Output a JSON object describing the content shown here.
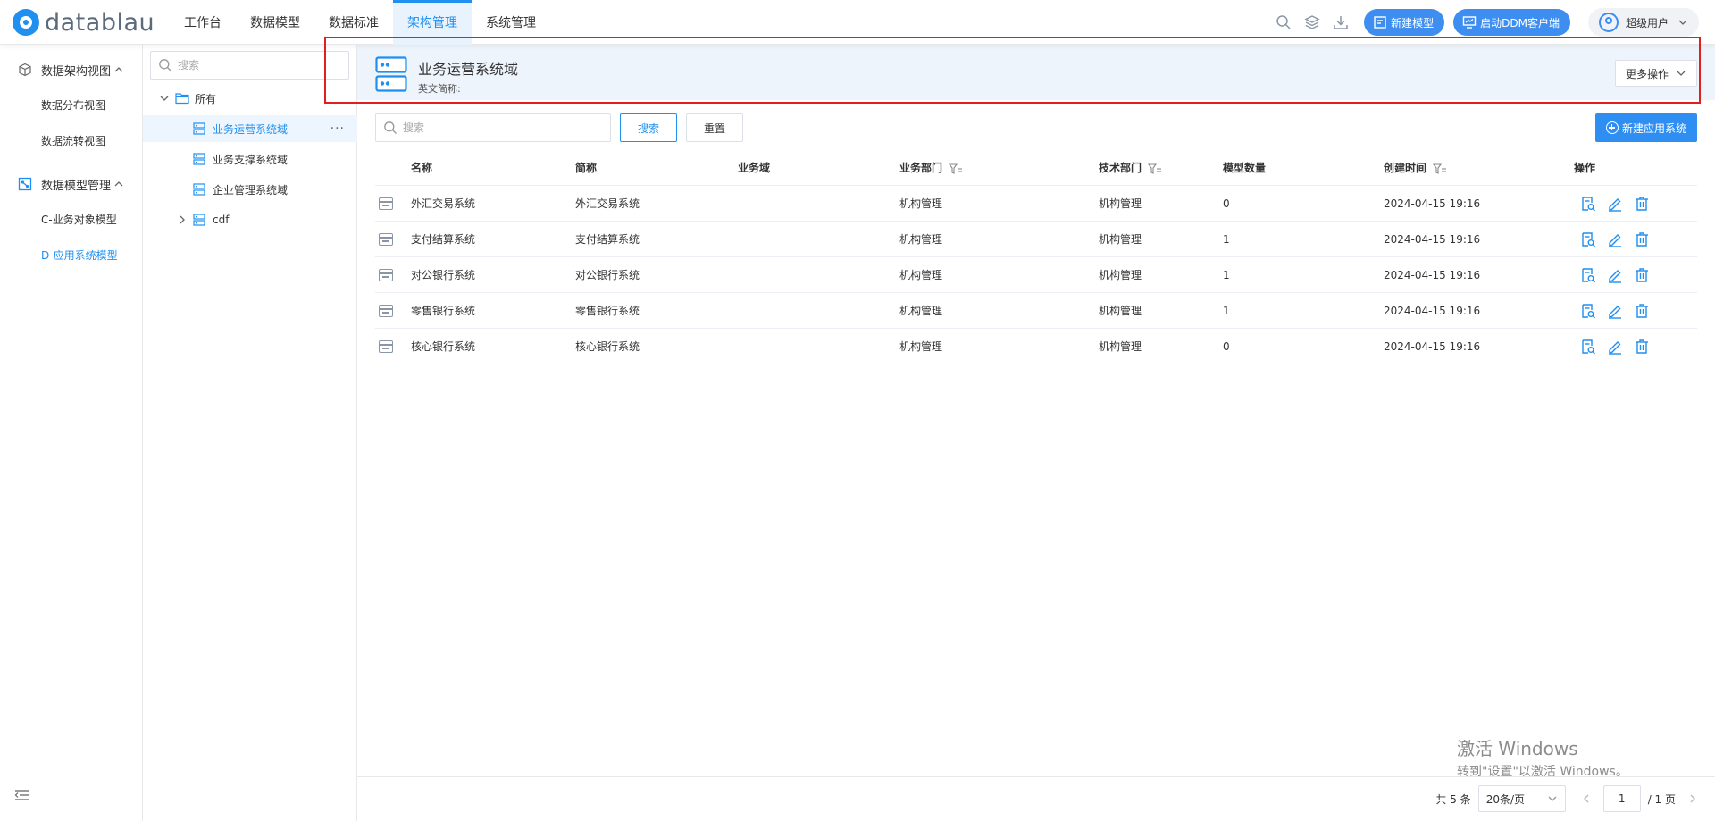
{
  "brand": {
    "name": "datablau"
  },
  "nav": {
    "items": [
      "工作台",
      "数据模型",
      "数据标准",
      "架构管理",
      "系统管理"
    ],
    "active_index": 3
  },
  "tools": {
    "new_model_label": "新建模型",
    "launch_ddm_label": "启动DDM客户端",
    "user_label": "超级用户"
  },
  "sidebar": {
    "groups": [
      {
        "label": "数据架构视图",
        "items": [
          "数据分布视图",
          "数据流转视图"
        ]
      },
      {
        "label": "数据模型管理",
        "items": [
          "C-业务对象模型",
          "D-应用系统模型"
        ]
      }
    ],
    "active_item": "D-应用系统模型"
  },
  "tree": {
    "search_placeholder": "搜索",
    "root_label": "所有",
    "nodes": [
      "业务运营系统域",
      "业务支撑系统域",
      "企业管理系统域",
      "cdf"
    ],
    "more_glyph": "···"
  },
  "header": {
    "title": "业务运营系统域",
    "subtitle": "英文简称:",
    "more_ops_label": "更多操作"
  },
  "toolbar": {
    "search_placeholder": "搜索",
    "search_label": "搜索",
    "reset_label": "重置",
    "new_app_label": "新建应用系统"
  },
  "table": {
    "columns": [
      "名称",
      "简称",
      "业务域",
      "业务部门",
      "技术部门",
      "模型数量",
      "创建时间",
      "操作"
    ],
    "rows": [
      {
        "name": "外汇交易系统",
        "abbr": "外汇交易系统",
        "domain": "",
        "biz_dept": "机构管理",
        "tech_dept": "机构管理",
        "models": "0",
        "created": "2024-04-15 19:16"
      },
      {
        "name": "支付结算系统",
        "abbr": "支付结算系统",
        "domain": "",
        "biz_dept": "机构管理",
        "tech_dept": "机构管理",
        "models": "1",
        "created": "2024-04-15 19:16"
      },
      {
        "name": "对公银行系统",
        "abbr": "对公银行系统",
        "domain": "",
        "biz_dept": "机构管理",
        "tech_dept": "机构管理",
        "models": "1",
        "created": "2024-04-15 19:16"
      },
      {
        "name": "零售银行系统",
        "abbr": "零售银行系统",
        "domain": "",
        "biz_dept": "机构管理",
        "tech_dept": "机构管理",
        "models": "1",
        "created": "2024-04-15 19:16"
      },
      {
        "name": "核心银行系统",
        "abbr": "核心银行系统",
        "domain": "",
        "biz_dept": "机构管理",
        "tech_dept": "机构管理",
        "models": "0",
        "created": "2024-04-15 19:16"
      }
    ]
  },
  "pager": {
    "total": "共 5 条",
    "page_size": "20条/页",
    "page": "1",
    "pages": "/ 1 页"
  },
  "watermark": {
    "line1": "激活 Windows",
    "line2": "转到\"设置\"以激活 Windows。"
  },
  "colors": {
    "accent": "#1f8ff0",
    "highlight_frame": "#e02020",
    "header_bg": "#eef4fc"
  }
}
